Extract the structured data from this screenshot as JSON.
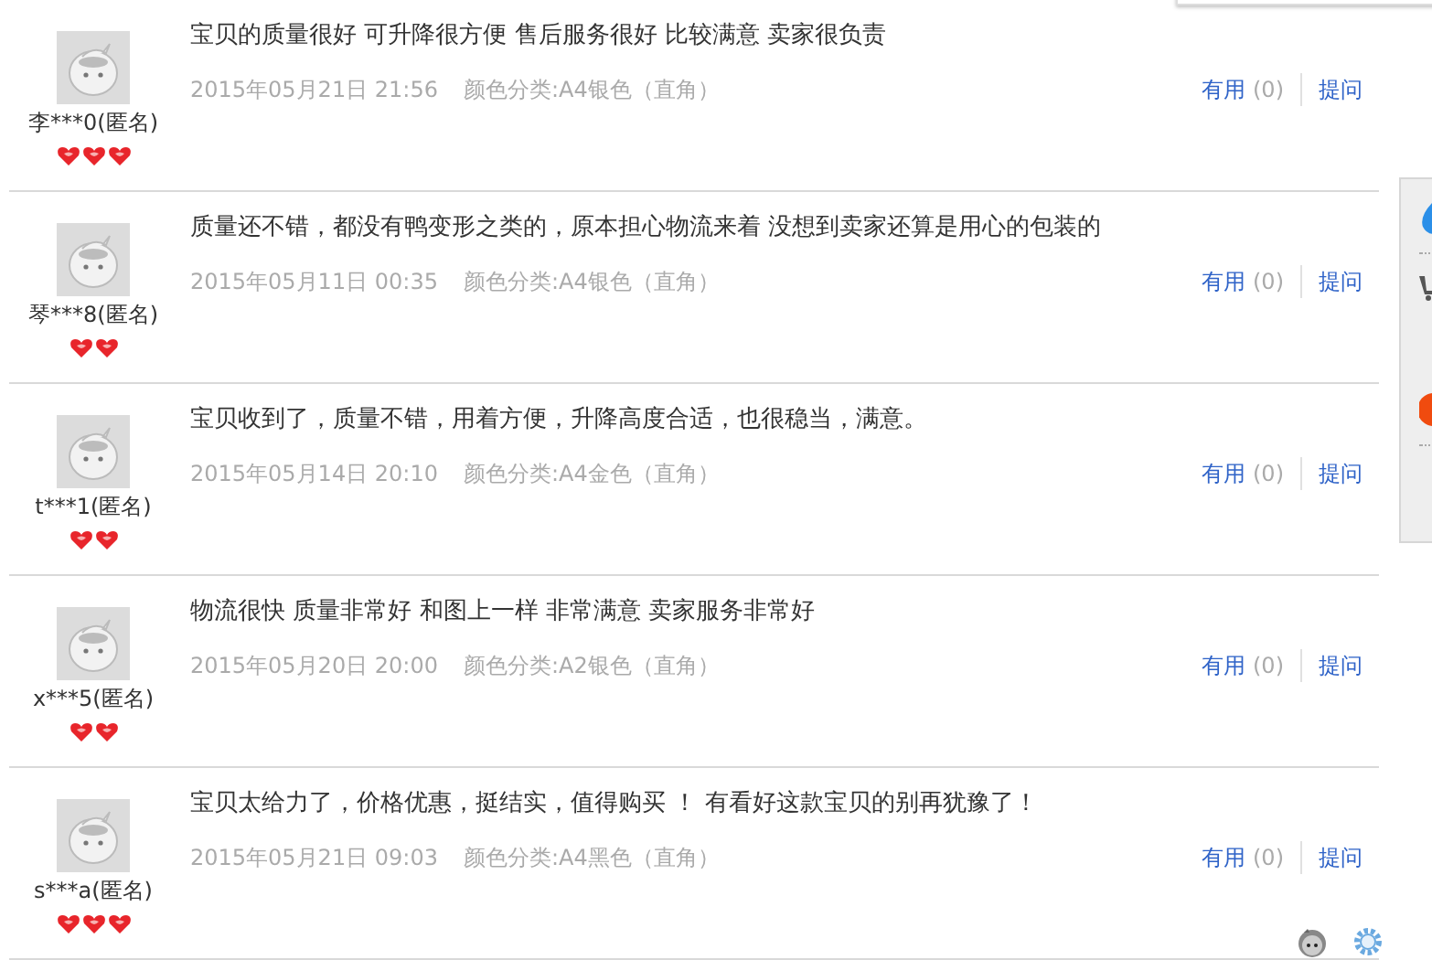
{
  "reviews": [
    {
      "user": "李***0(匿名)",
      "kind": "three-hearts",
      "comment": "宝贝的质量很好 可升降很方便 售后服务很好 比较满意 卖家很负责",
      "date": "2015年05月21日 21:56",
      "sku": "颜色分类:A4银色（直角）",
      "useful": "有用",
      "useful_count": "(0)",
      "ask": "提问"
    },
    {
      "user": "琴***8(匿名)",
      "kind": "two-hearts",
      "comment": "质量还不错，都没有鸭变形之类的，原本担心物流来着 没想到卖家还算是用心的包装的",
      "date": "2015年05月11日 00:35",
      "sku": "颜色分类:A4银色（直角）",
      "useful": "有用",
      "useful_count": "(0)",
      "ask": "提问"
    },
    {
      "user": "t***1(匿名)",
      "kind": "two-hearts",
      "comment": "宝贝收到了，质量不错，用着方便，升降高度合适，也很稳当，满意。",
      "date": "2015年05月14日 20:10",
      "sku": "颜色分类:A4金色（直角）",
      "useful": "有用",
      "useful_count": "(0)",
      "ask": "提问"
    },
    {
      "user": "x***5(匿名)",
      "kind": "two-hearts",
      "comment": "物流很快 质量非常好 和图上一样 非常满意 卖家服务非常好",
      "date": "2015年05月20日 20:00",
      "sku": "颜色分类:A2银色（直角）",
      "useful": "有用",
      "useful_count": "(0)",
      "ask": "提问"
    },
    {
      "user": "s***a(匿名)",
      "kind": "three-hearts",
      "comment": "宝贝太给力了，价格优惠，挺结实，值得购买 ！ 有看好这款宝贝的别再犹豫了！",
      "date": "2015年05月21日 09:03",
      "sku": "颜色分类:A4黑色（直角）",
      "useful": "有用",
      "useful_count": "(0)",
      "ask": "提问"
    }
  ]
}
